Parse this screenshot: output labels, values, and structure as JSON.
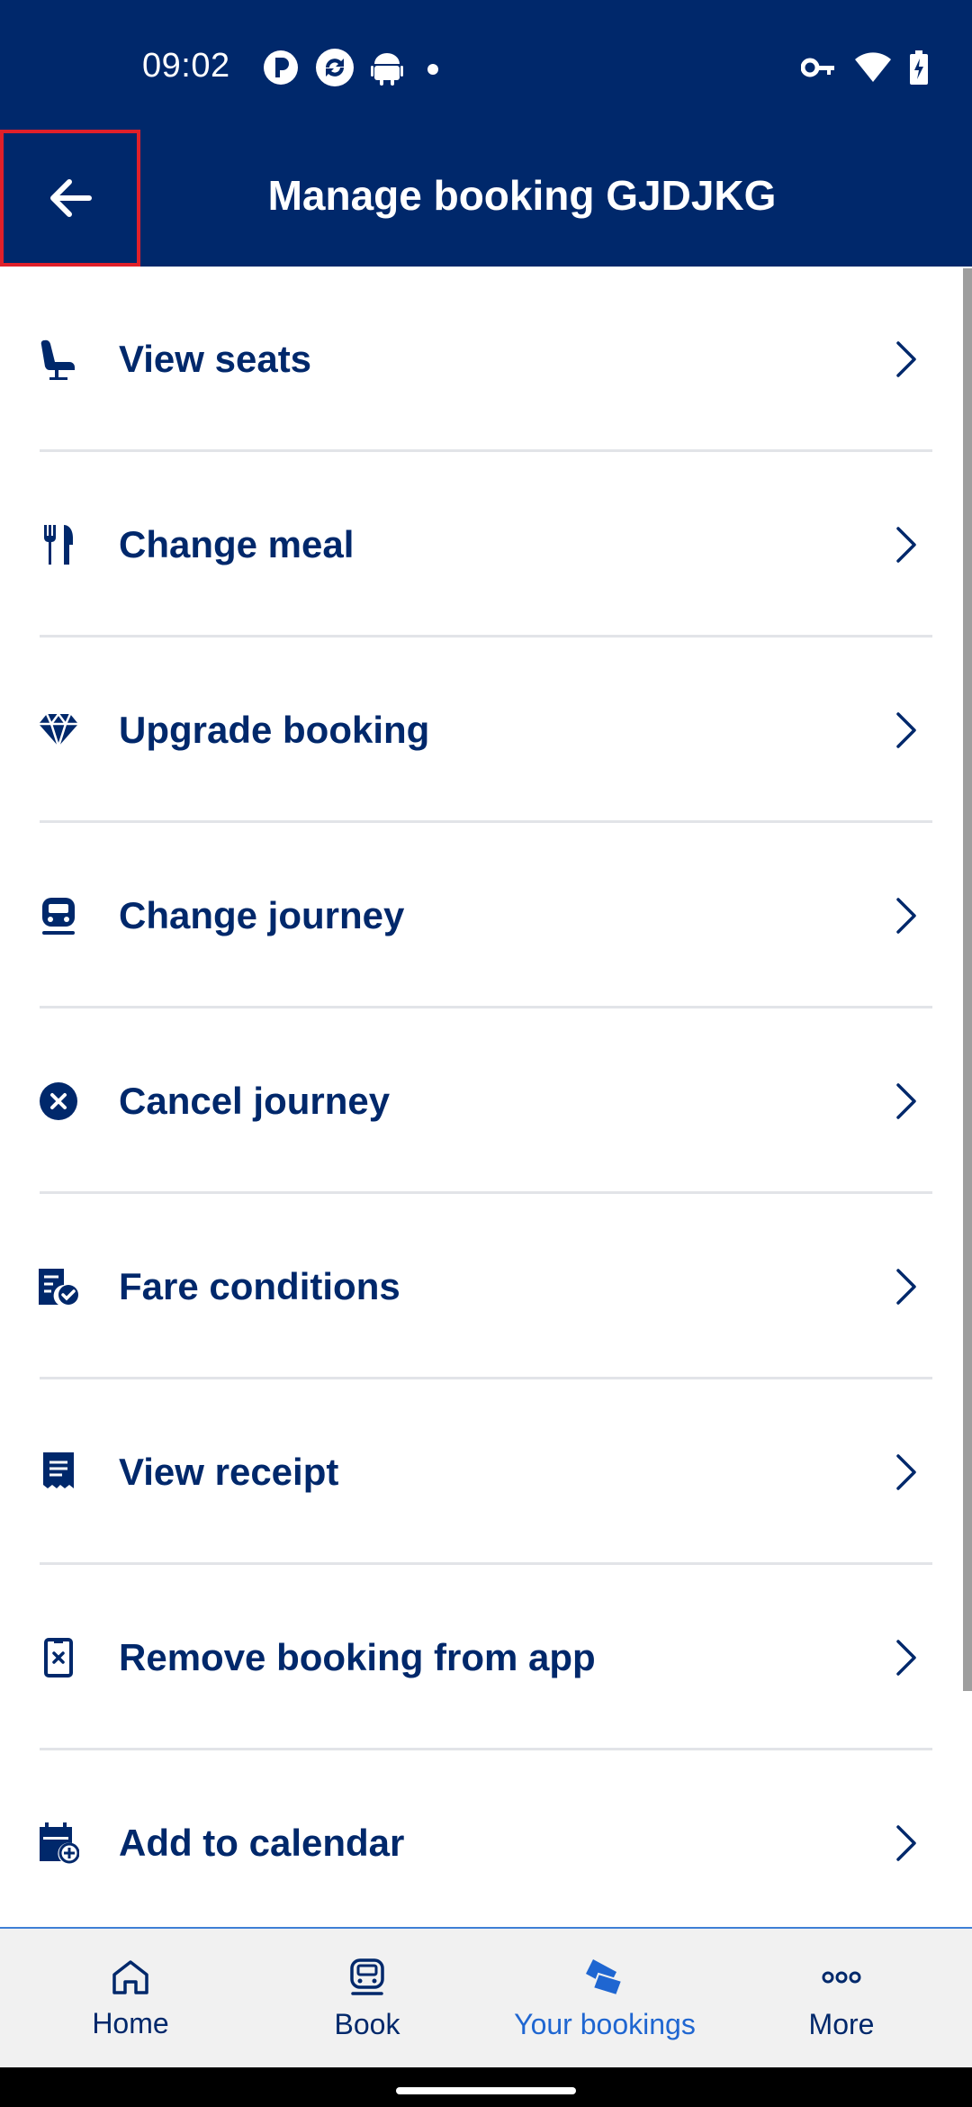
{
  "status_bar": {
    "time": "09:02"
  },
  "header": {
    "title": "Manage booking GJDJKG",
    "back_icon": "arrow-left-icon"
  },
  "menu": [
    {
      "label": "View seats",
      "icon": "seat-icon"
    },
    {
      "label": "Change meal",
      "icon": "cutlery-icon"
    },
    {
      "label": "Upgrade booking",
      "icon": "diamond-icon"
    },
    {
      "label": "Change journey",
      "icon": "train-icon"
    },
    {
      "label": "Cancel journey",
      "icon": "cancel-circle-icon"
    },
    {
      "label": "Fare conditions",
      "icon": "document-check-icon"
    },
    {
      "label": "View receipt",
      "icon": "receipt-icon"
    },
    {
      "label": "Remove booking from app",
      "icon": "phone-remove-icon"
    },
    {
      "label": "Add to calendar",
      "icon": "calendar-add-icon"
    }
  ],
  "bottom_nav": [
    {
      "label": "Home",
      "icon": "home-icon",
      "active": false
    },
    {
      "label": "Book",
      "icon": "train-icon",
      "active": false
    },
    {
      "label": "Your bookings",
      "icon": "tickets-icon",
      "active": true
    },
    {
      "label": "More",
      "icon": "more-dots-icon",
      "active": false
    }
  ],
  "colors": {
    "primary": "#00286b",
    "accent": "#1f66d1",
    "divider": "#e2e4e8",
    "highlight_border": "#e0202a"
  }
}
